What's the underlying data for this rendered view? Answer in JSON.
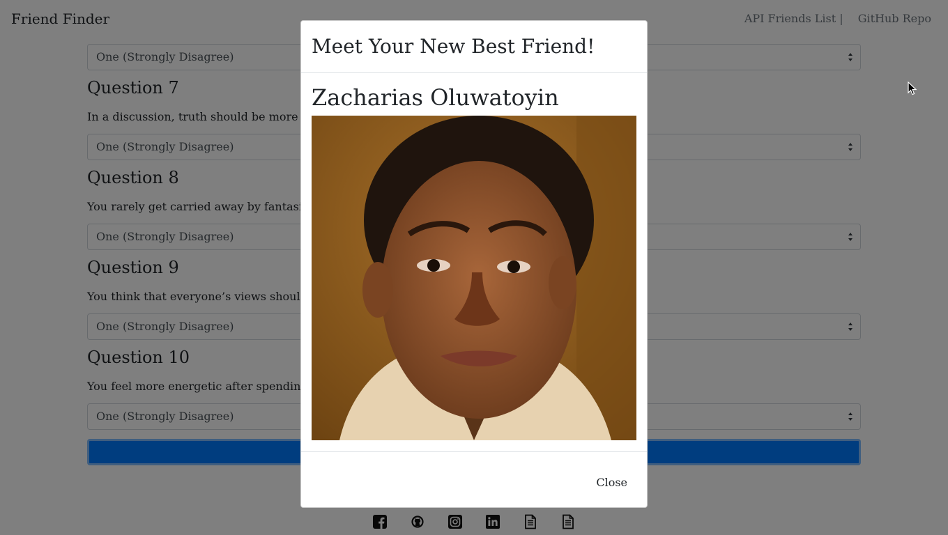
{
  "navbar": {
    "brand": "Friend Finder",
    "links": [
      "API Friends List |",
      "GitHub Repo"
    ]
  },
  "survey": {
    "default_option": "One (Strongly Disagree)",
    "questions": [
      {
        "title": "Question 7",
        "text": "In a discussion, truth should be more impor"
      },
      {
        "title": "Question 8",
        "text": "You rarely get carried away by fantasies and"
      },
      {
        "title": "Question 9",
        "text": "You think that everyone’s views should be r"
      },
      {
        "title": "Question 10",
        "text": "You feel more energetic after spending time"
      }
    ]
  },
  "modal": {
    "title": "Meet Your New Best Friend!",
    "friend_name": "Zacharias Oluwatoyin",
    "close_label": "Close"
  },
  "footer": {
    "icons": [
      "facebook-icon",
      "github-icon",
      "instagram-icon",
      "linkedin-icon",
      "document-icon",
      "document-icon"
    ]
  },
  "colors": {
    "primary": "#007bff",
    "backdrop": "rgba(0,0,0,0.5)"
  }
}
